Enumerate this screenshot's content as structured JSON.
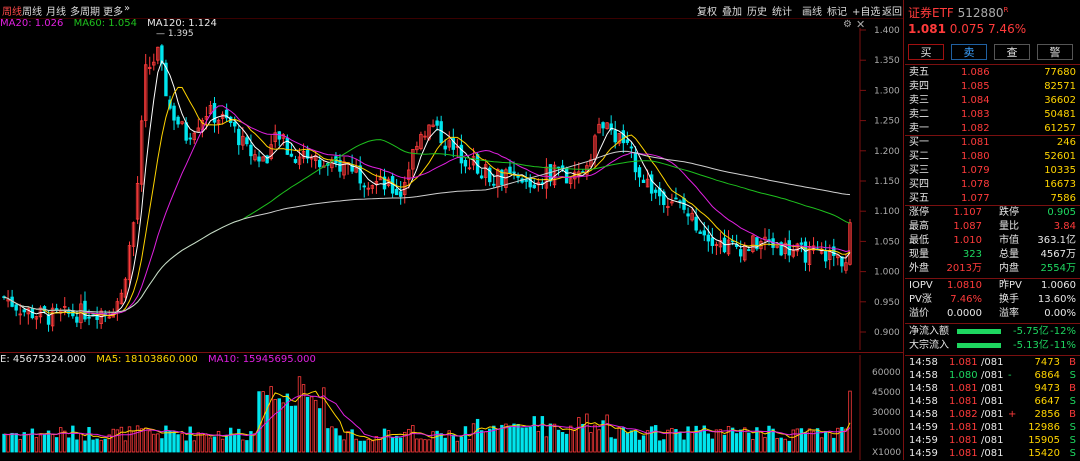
{
  "toolbar": {
    "left": [
      "周线",
      "周线",
      "月线",
      "多周期",
      "更多",
      "»"
    ],
    "right": [
      "复权",
      "叠加",
      "历史",
      "统计",
      "画线",
      "标记",
      "+自选",
      "返回"
    ]
  },
  "ma": {
    "ma20": "MA20: 1.026",
    "ma60": "MA60: 1.054",
    "ma120": "MA120: 1.124"
  },
  "vol_ma": {
    "vol": "E: 45675324.000",
    "ma5": "MA5: 18103860.000",
    "ma10": "MA10: 15945695.000"
  },
  "price_axis": [
    "1.400",
    "1.350",
    "1.300",
    "1.250",
    "1.200",
    "1.150",
    "1.100",
    "1.050",
    "1.000",
    "0.950",
    "0.900"
  ],
  "vol_axis": [
    "60000",
    "45000",
    "30000",
    "15000",
    "X1000"
  ],
  "peak_label": "1.395",
  "quote": {
    "name": "证券ETF",
    "code": "512880",
    "flag": "R",
    "price": "1.081",
    "change": "0.075",
    "pct": "7.46%",
    "buttons": [
      "买",
      "卖",
      "查",
      "警"
    ]
  },
  "sells": [
    {
      "label": "卖五",
      "price": "1.086",
      "vol": "77680"
    },
    {
      "label": "卖四",
      "price": "1.085",
      "vol": "82571"
    },
    {
      "label": "卖三",
      "price": "1.084",
      "vol": "36602"
    },
    {
      "label": "卖二",
      "price": "1.083",
      "vol": "50481"
    },
    {
      "label": "卖一",
      "price": "1.082",
      "vol": "61257"
    }
  ],
  "buys": [
    {
      "label": "买一",
      "price": "1.081",
      "vol": "246"
    },
    {
      "label": "买二",
      "price": "1.080",
      "vol": "52601"
    },
    {
      "label": "买三",
      "price": "1.079",
      "vol": "10335"
    },
    {
      "label": "买四",
      "price": "1.078",
      "vol": "16673"
    },
    {
      "label": "买五",
      "price": "1.077",
      "vol": "7586"
    }
  ],
  "stats": [
    {
      "l1": "涨停",
      "v1": "1.107",
      "c1": "red",
      "l2": "跌停",
      "v2": "0.905",
      "c2": "green"
    },
    {
      "l1": "最高",
      "v1": "1.087",
      "c1": "red",
      "l2": "量比",
      "v2": "3.84",
      "c2": "red"
    },
    {
      "l1": "最低",
      "v1": "1.010",
      "c1": "red",
      "l2": "市值",
      "v2": "363.1亿",
      "c2": "white"
    },
    {
      "l1": "现量",
      "v1": "323",
      "c1": "green",
      "l2": "总量",
      "v2": "4567万",
      "c2": "white"
    },
    {
      "l1": "外盘",
      "v1": "2013万",
      "c1": "red",
      "l2": "内盘",
      "v2": "2554万",
      "c2": "green"
    }
  ],
  "iopv": [
    {
      "l1": "IOPV",
      "v1": "1.0810",
      "c1": "red",
      "l2": "昨PV",
      "v2": "1.0060",
      "c2": "white"
    },
    {
      "l1": "PV涨",
      "v1": "7.46%",
      "c1": "red",
      "l2": "换手",
      "v2": "13.60%",
      "c2": "white"
    },
    {
      "l1": "溢价",
      "v1": "0.0000",
      "c1": "white",
      "l2": "溢率",
      "v2": "0.00%",
      "c2": "white"
    }
  ],
  "flows": [
    {
      "label": "净流入额",
      "value": "-5.75亿",
      "pct": "-12%",
      "fill": 0.88
    },
    {
      "label": "大宗流入",
      "value": "-5.13亿",
      "pct": "-11%",
      "fill": 0.88
    }
  ],
  "ticks": [
    {
      "time": "14:58",
      "price": "1.081",
      "tail": "/081",
      "mark": "",
      "vol": "7473",
      "side": "B"
    },
    {
      "time": "14:58",
      "price": "1.080",
      "tail": "/081",
      "mark": "-",
      "vol": "6864",
      "side": "S"
    },
    {
      "time": "14:58",
      "price": "1.081",
      "tail": "/081",
      "mark": "",
      "vol": "9473",
      "side": "B"
    },
    {
      "time": "14:58",
      "price": "1.081",
      "tail": "/081",
      "mark": "",
      "vol": "6647",
      "side": "S"
    },
    {
      "time": "14:58",
      "price": "1.082",
      "tail": "/081",
      "mark": "+",
      "vol": "2856",
      "side": "B"
    },
    {
      "time": "14:59",
      "price": "1.081",
      "tail": "/081",
      "mark": "",
      "vol": "12986",
      "side": "S"
    },
    {
      "time": "14:59",
      "price": "1.081",
      "tail": "/081",
      "mark": "",
      "vol": "15905",
      "side": "S"
    },
    {
      "time": "14:59",
      "price": "1.081",
      "tail": "/081",
      "mark": "",
      "vol": "15420",
      "side": "S"
    }
  ],
  "colors": {
    "up": "#ff3b3b",
    "down": "#00e5ee",
    "ma5": "#ffffff",
    "ma10": "#ffd400",
    "ma20": "#e020e0",
    "ma60": "#1ec01e",
    "ma120": "#cfcfcf"
  }
}
